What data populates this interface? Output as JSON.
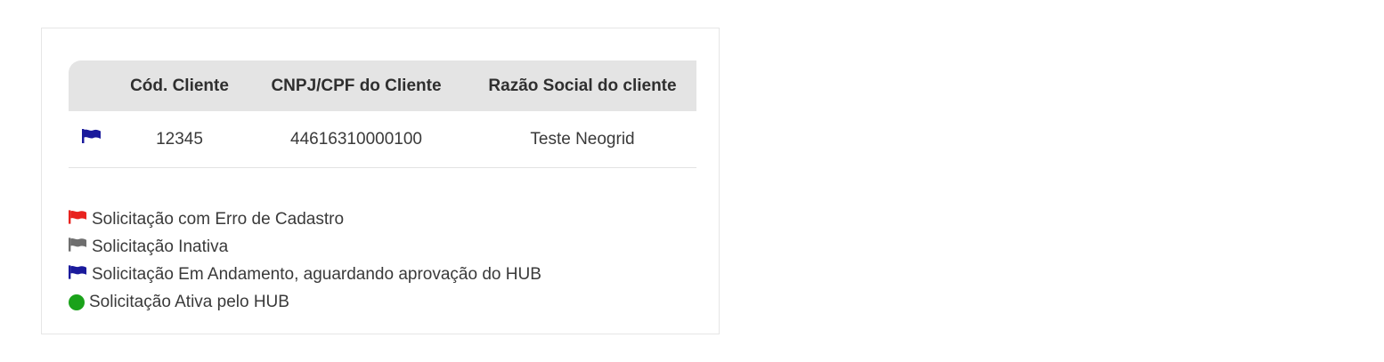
{
  "colors": {
    "flag_error": "#e8231f",
    "flag_inactive": "#6e6e6e",
    "flag_progress": "#1a1a9c",
    "dot_active": "#1aa21a",
    "header_bg": "#e4e4e4"
  },
  "table": {
    "headers": {
      "flag": "",
      "cod_cliente": "Cód. Cliente",
      "cnpj_cpf": "CNPJ/CPF do Cliente",
      "razao_social": "Razão Social do cliente"
    },
    "rows": [
      {
        "status_icon": "flag-in-progress-icon",
        "cod_cliente": "12345",
        "cnpj_cpf": "44616310000100",
        "razao_social": "Teste Neogrid"
      }
    ]
  },
  "legend": {
    "items": [
      {
        "icon": "flag-error-icon",
        "label": "Solicitação com Erro de Cadastro"
      },
      {
        "icon": "flag-inactive-icon",
        "label": "Solicitação Inativa"
      },
      {
        "icon": "flag-in-progress-icon",
        "label": "Solicitação Em Andamento, aguardando aprovação do HUB"
      },
      {
        "icon": "active-dot-icon",
        "label": "Solicitação Ativa pelo HUB"
      }
    ]
  }
}
